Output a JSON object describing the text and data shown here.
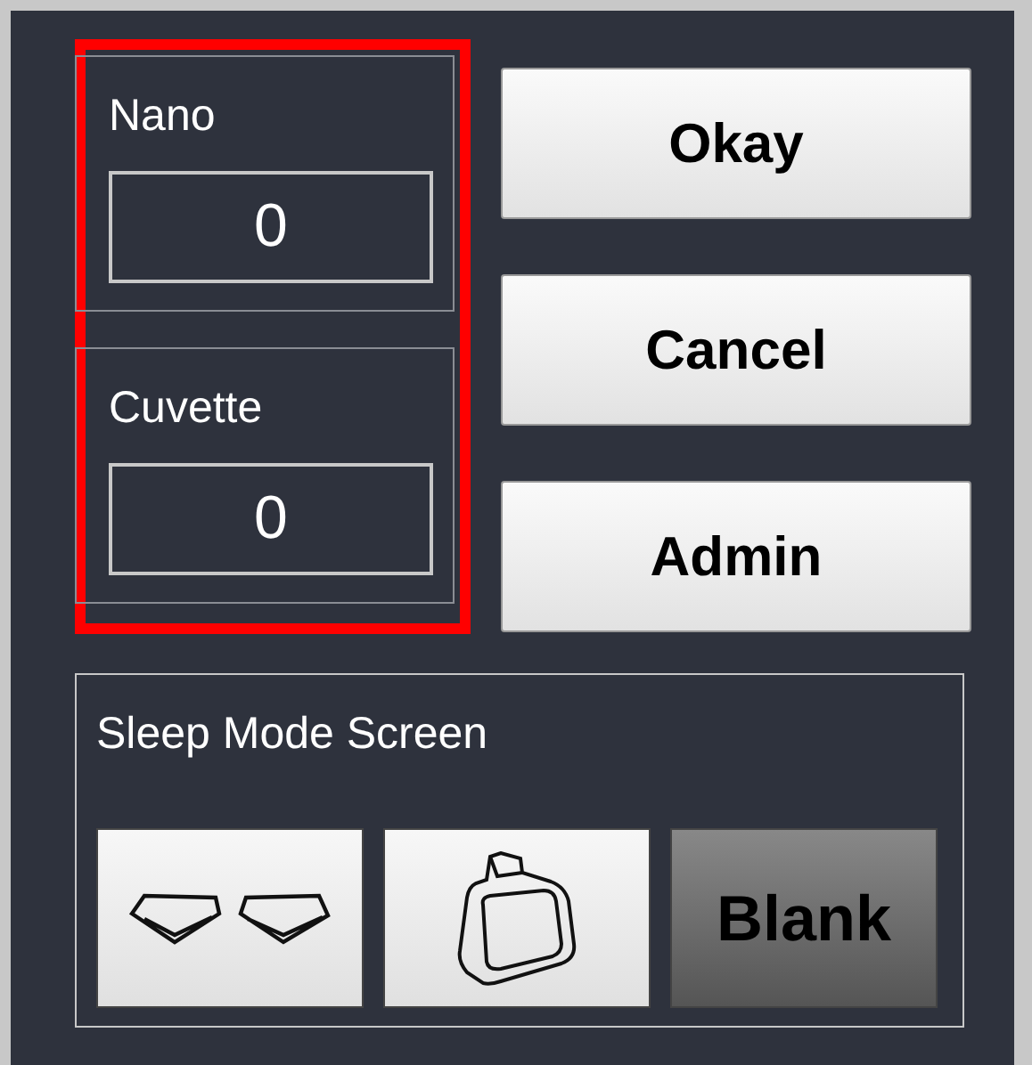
{
  "counters": [
    {
      "label": "Nano",
      "value": "0"
    },
    {
      "label": "Cuvette",
      "value": "0"
    }
  ],
  "highlighted": true,
  "buttons": [
    "Okay",
    "Cancel",
    "Admin"
  ],
  "sleep_mode": {
    "title": "Sleep Mode Screen",
    "options": [
      {
        "kind": "lenses",
        "selected": false
      },
      {
        "kind": "cuvette",
        "selected": false
      },
      {
        "kind": "text",
        "label": "Blank",
        "selected": true
      }
    ]
  }
}
